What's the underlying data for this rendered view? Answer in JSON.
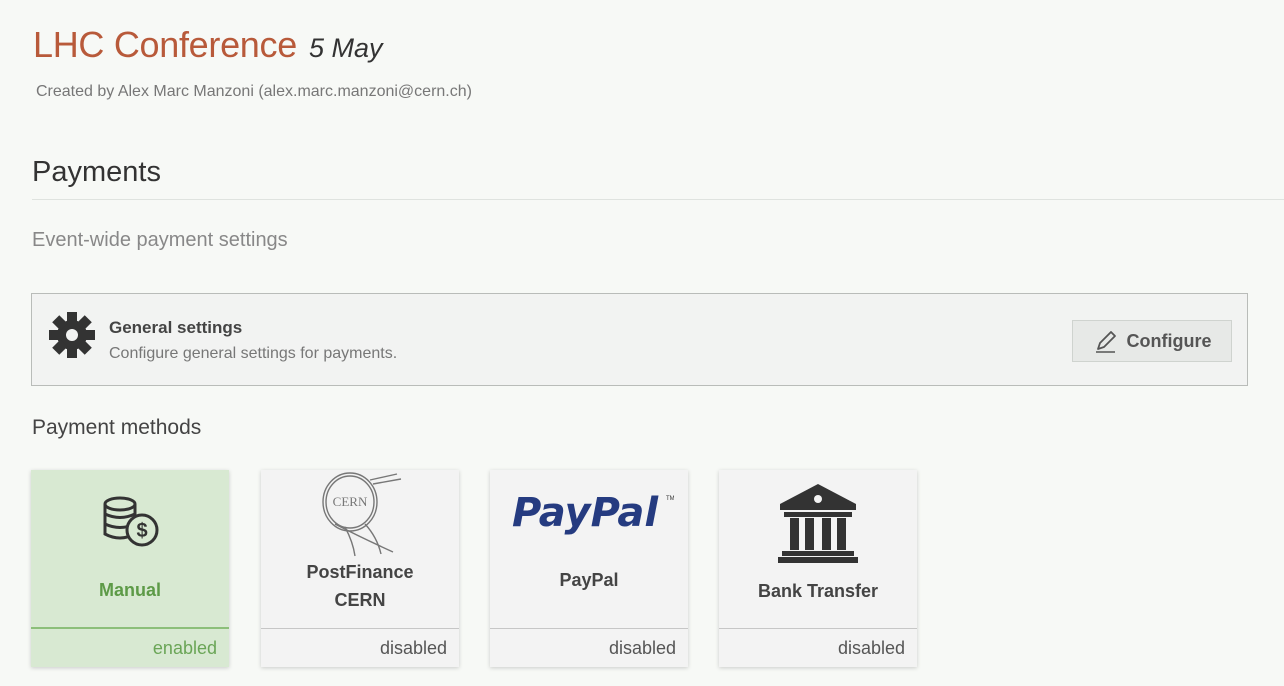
{
  "event": {
    "title": "LHC Conference",
    "date": "5 May",
    "creator": "Created by Alex Marc Manzoni (alex.marc.manzoni@cern.ch)"
  },
  "payments": {
    "title": "Payments",
    "subsection": "Event-wide payment settings",
    "general_settings": {
      "icon": "gear-icon",
      "title": "General settings",
      "description": "Configure general settings for payments.",
      "button_label": "Configure",
      "button_icon": "pencil-icon"
    },
    "methods_label": "Payment methods",
    "methods": [
      {
        "name_line1": "Manual",
        "name_line2": "",
        "status": "enabled",
        "icon": "coins-dollar-icon"
      },
      {
        "name_line1": "PostFinance",
        "name_line2": "CERN",
        "status": "disabled",
        "icon": "cern-logo-icon",
        "logo_text": "CERN"
      },
      {
        "name_line1": "PayPal",
        "name_line2": "",
        "status": "disabled",
        "icon": "paypal-logo-icon",
        "logo_text": "PayPal"
      },
      {
        "name_line1": "Bank Transfer",
        "name_line2": "",
        "status": "disabled",
        "icon": "bank-icon"
      }
    ]
  },
  "colors": {
    "title": "#b85a3a",
    "enabled_bg": "#d8e9d2",
    "enabled_text": "#5d9a47",
    "paypal_dark": "#253b80",
    "paypal_light": "#179bd7"
  }
}
